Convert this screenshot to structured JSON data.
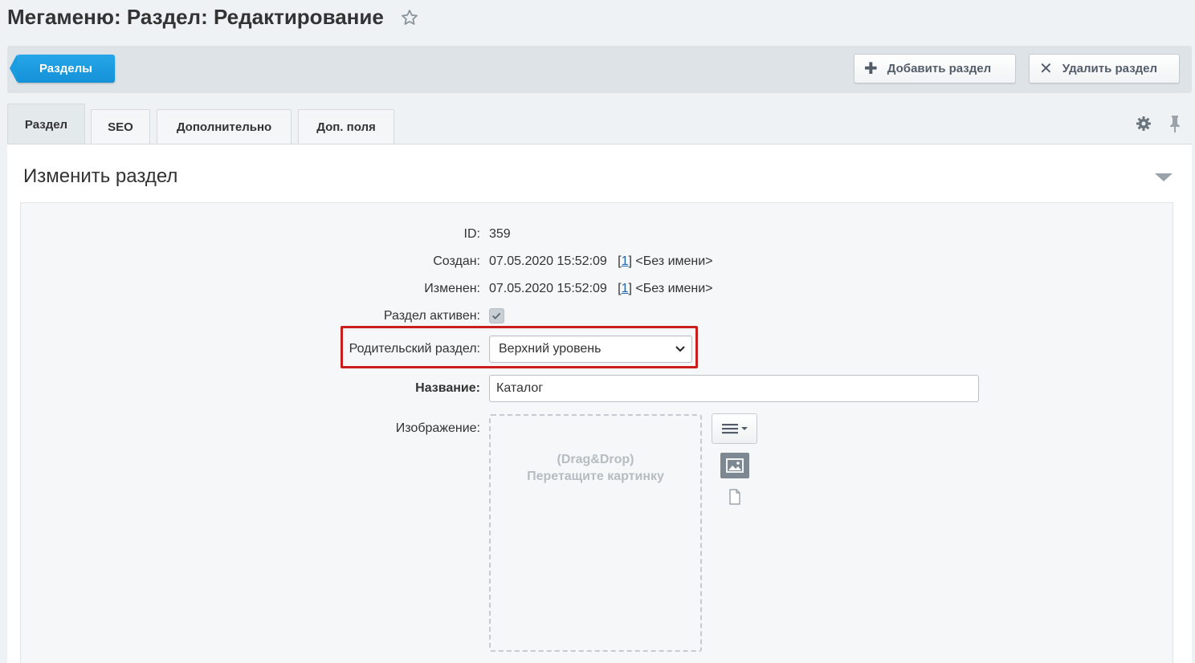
{
  "page": {
    "title": "Мегаменю: Раздел: Редактирование"
  },
  "toolbar": {
    "back_label": "Разделы",
    "add_label": "Добавить раздел",
    "delete_label": "Удалить раздел"
  },
  "tabs": [
    {
      "label": "Раздел",
      "active": true
    },
    {
      "label": "SEO",
      "active": false
    },
    {
      "label": "Дополнительно",
      "active": false
    },
    {
      "label": "Доп. поля",
      "active": false
    }
  ],
  "card": {
    "title": "Изменить раздел"
  },
  "form": {
    "id_label": "ID:",
    "id_value": "359",
    "created_label": "Создан:",
    "created_date": "07.05.2020 15:52:09",
    "created_user_id": "1",
    "created_user_name": "<Без имени>",
    "modified_label": "Изменен:",
    "modified_date": "07.05.2020 15:52:09",
    "modified_user_id": "1",
    "modified_user_name": "<Без имени>",
    "active_label": "Раздел активен:",
    "active_checked": true,
    "parent_label": "Родительский раздел:",
    "parent_value": "Верхний уровень",
    "name_label": "Название:",
    "name_value": "Каталог",
    "image_label": "Изображение:",
    "dropzone_line1": "(Drag&Drop)",
    "dropzone_line2": "Перетащите картинку"
  },
  "colors": {
    "accent": "#1c9ce0",
    "highlight": "#c81e1e",
    "link": "#2067b0"
  }
}
